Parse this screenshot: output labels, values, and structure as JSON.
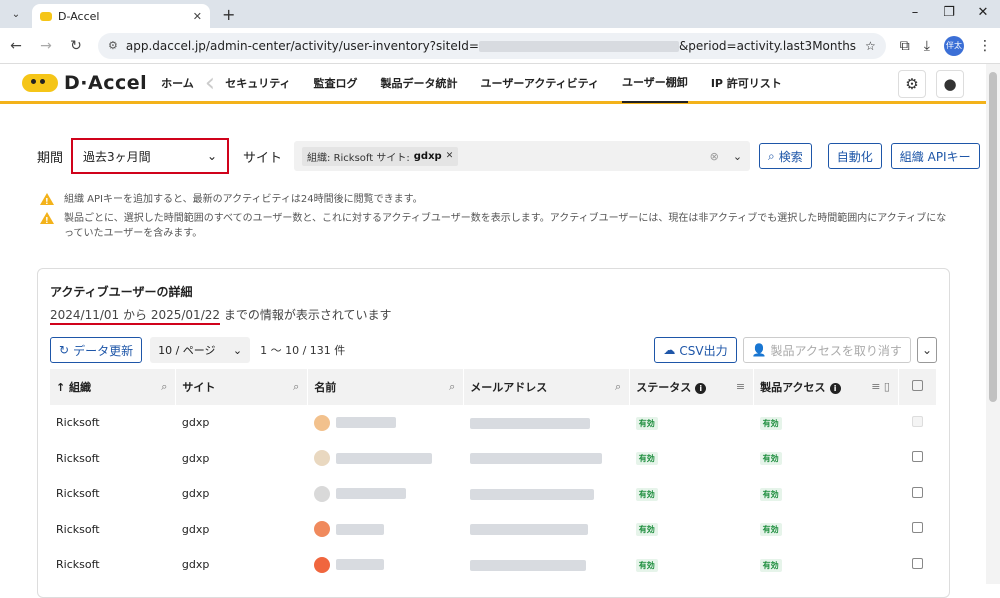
{
  "browser": {
    "tab_title": "D-Accel",
    "url_prefix": "app.daccel.jp/admin-center/activity/user-inventory?siteId=",
    "url_suffix": "&period=activity.last3Months",
    "profile_label": "伴太"
  },
  "app": {
    "logo_text": "D·Accel",
    "nav": [
      {
        "label": "ホーム"
      },
      {
        "label": "セキュリティ"
      },
      {
        "label": "監査ログ"
      },
      {
        "label": "製品データ統計"
      },
      {
        "label": "ユーザーアクティビティ"
      },
      {
        "label": "ユーザー棚卸"
      },
      {
        "label": "IP 許可リスト"
      }
    ]
  },
  "filters": {
    "period_label": "期間",
    "period_value": "過去3ヶ月間",
    "site_label": "サイト",
    "site_chip_prefix": "組織: Ricksoft サイト:",
    "site_chip_value": "gdxp",
    "search_button": "検索",
    "automate_button": "自動化",
    "api_key_button": "組織 APIキー"
  },
  "notices": [
    "組織 APIキーを追加すると、最新のアクティビティは24時間後に閲覧できます。",
    "製品ごとに、選択した時間範囲のすべてのユーザー数と、これに対するアクティブユーザー数を表示します。アクティブユーザーには、現在は非アクティブでも選択した時間範囲内にアクティブになっていたユーザーを含みます。"
  ],
  "card": {
    "title": "アクティブユーザーの詳細",
    "range_start": "2024/11/01",
    "range_from": "から",
    "range_end": "2025/01/22",
    "range_suffix": "までの情報が表示されています",
    "refresh_button": "データ更新",
    "per_page": "10 / ページ",
    "count": "1 〜 10 / 131 件",
    "csv_button": "CSV出力",
    "revoke_button": "製品アクセスを取り消す"
  },
  "table": {
    "headers": [
      "↑ 組織",
      "サイト",
      "名前",
      "メールアドレス",
      "ステータス",
      "製品アクセス"
    ],
    "rows": [
      {
        "org": "Ricksoft",
        "site": "gdxp",
        "status": "有効",
        "access": "有効"
      },
      {
        "org": "Ricksoft",
        "site": "gdxp",
        "status": "有効",
        "access": "有効"
      },
      {
        "org": "Ricksoft",
        "site": "gdxp",
        "status": "有効",
        "access": "有効"
      },
      {
        "org": "Ricksoft",
        "site": "gdxp",
        "status": "有効",
        "access": "有効"
      },
      {
        "org": "Ricksoft",
        "site": "gdxp",
        "status": "有効",
        "access": "有効"
      }
    ]
  },
  "colors": {
    "accent": "#f3b21a",
    "highlight": "#d0021b",
    "primary": "#1e56a8"
  }
}
